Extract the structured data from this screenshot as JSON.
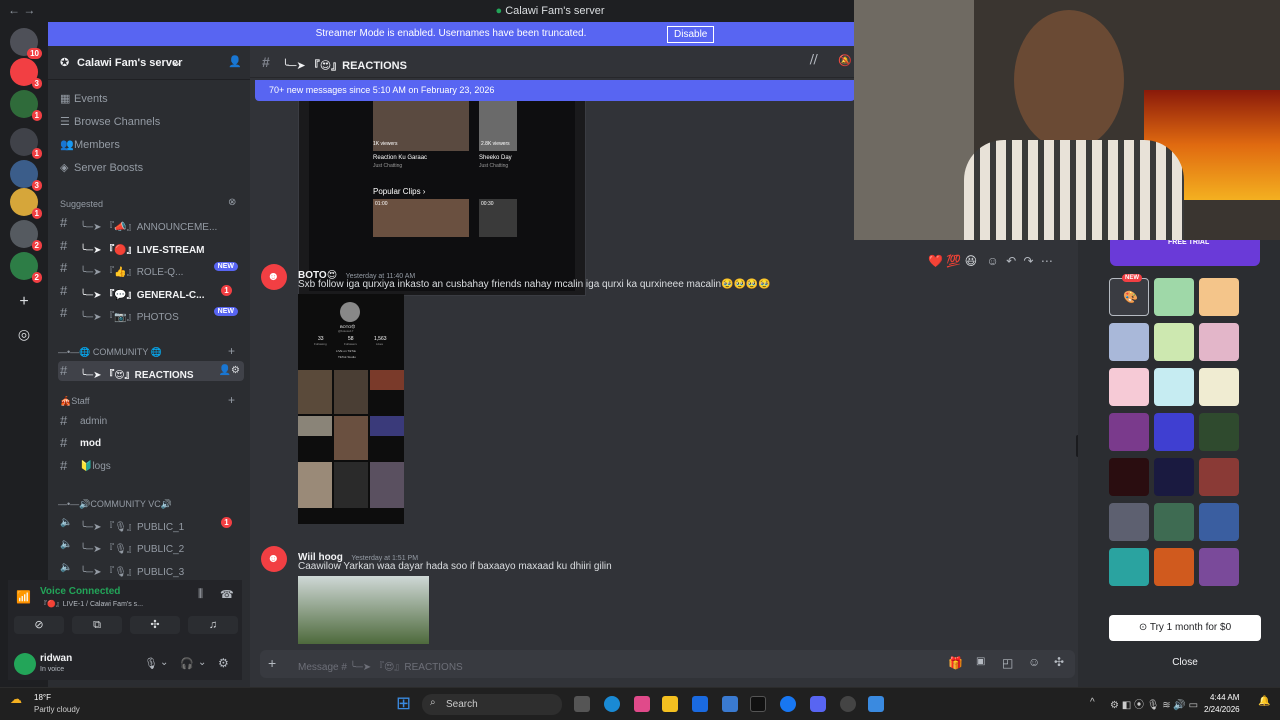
{
  "window": {
    "title": "Calawi Fam's server",
    "nav_arrows": "←  →"
  },
  "banner": {
    "text": "Streamer Mode is enabled. Usernames have been truncated.",
    "button": "Disable"
  },
  "guilds": [
    {
      "badge": "10",
      "color": "#4e5058"
    },
    {
      "badge": "3",
      "color": "#f23f43"
    },
    {
      "badge": "1",
      "color": "#2f6b3a"
    },
    {
      "badge": "1",
      "color": "#404249"
    },
    {
      "badge": "3",
      "color": "#3b5d8a"
    },
    {
      "badge": "1",
      "color": "#d6a63a"
    },
    {
      "badge": "2",
      "color": "#555a60"
    },
    {
      "badge": "2",
      "color": "#2d7d46"
    }
  ],
  "sidebar": {
    "server_name": "Calawi Fam's server",
    "nav": [
      {
        "label": "Events",
        "icon": "calendar-icon",
        "glyph": "▦"
      },
      {
        "label": "Browse Channels",
        "icon": "browse-icon",
        "glyph": "☰"
      },
      {
        "label": "Members",
        "icon": "members-icon",
        "glyph": "👥"
      },
      {
        "label": "Server Boosts",
        "icon": "boost-icon",
        "glyph": "◈"
      }
    ],
    "suggested_label": "Suggested",
    "channels_suggested": [
      {
        "name": "╰─➤ 『📣』ANNOUNCEME...",
        "badge": "",
        "bold": false
      },
      {
        "name": "╰─➤ 『🔴』LIVE-STREAM",
        "badge": "",
        "bold": true
      },
      {
        "name": "╰─➤ 『👍』ROLE-Q...",
        "badge": "NEW",
        "bold": false
      },
      {
        "name": "╰─➤ 『💬』GENERAL-C...",
        "badge": "1",
        "bold": true
      },
      {
        "name": "╰─➤ 『📷』PHOTOS",
        "badge": "NEW",
        "bold": false
      }
    ],
    "community_label": "—•—🌐 COMMUNITY 🌐",
    "active_channel": "╰─➤ 『😍』REACTIONS",
    "staff_label": "🎪Staff",
    "staff_channels": [
      "admin",
      "mod",
      "🔰logs"
    ],
    "community_vc_label": "—•—🔊COMMUNITY VC🔊",
    "voice_channels": [
      {
        "name": "╰─➤ 『🎙』PUBLIC_1",
        "badge": "1"
      },
      {
        "name": "╰─➤ 『🎙』PUBLIC_2",
        "badge": ""
      },
      {
        "name": "╰─➤ 『🎙』PUBLIC_3",
        "badge": ""
      }
    ]
  },
  "voice": {
    "status": "Voice Connected",
    "channel": "『🔴』LIVE-1 / Calawi Fam's s..."
  },
  "user": {
    "name": "ridwan",
    "status": "In voice"
  },
  "channel_header": {
    "name": "╰─➤ 『😍』REACTIONS"
  },
  "new_messages_bar": "70+ new messages since 5:10 AM on February 23, 2026",
  "embedded_preview": {
    "clip1_title": "Reaction Ku Garaac",
    "clip1_views": "1K viewers",
    "clip2_title": "Sheeko Day",
    "clip2_views": "2.8K viewers",
    "clip_sub": "Just Chatting",
    "popular_clips": "Popular Clips  ›",
    "t1": "01:00",
    "t2": "00:30"
  },
  "messages": [
    {
      "author": "BOTO😍",
      "time": "Yesterday at 11:40 AM",
      "text": "Sxb follow iga qurxiya inkasto  an cusbahay friends  nahay mcalin iga qurxi  ka qurxineee macalin🥹🥹🥹🥹",
      "profile": {
        "name": "BOTO😍",
        "handle": "@botosu17",
        "following": "33",
        "followers": "58",
        "likes": "1,563",
        "following_label": "Following",
        "followers_label": "Followers",
        "likes_label": "Likes",
        "bio": "LIVE on TikTok",
        "studio": "TikTok Studio"
      }
    },
    {
      "author": "Wiil hoog",
      "time": "Yesterday at 1:51 PM",
      "text": "Caawilow Yarkan waa dayar hada soo if baxaayo maxaad ku dhiiri gilin"
    }
  ],
  "composer": {
    "placeholder": "Message # ╰─➤ 『😍』REACTIONS"
  },
  "reactions_bar": [
    "❤️",
    "💯",
    "😆"
  ],
  "side_panel": {
    "trial_label": "FREE TRIAL",
    "new_badge": "NEW",
    "try_button": "Try 1 month for $0",
    "close_button": "Close",
    "swatches": [
      "#3a3c42",
      "#9fd8a8",
      "#f4c58a",
      "#a9b8d9",
      "#cde8b0",
      "#e3b6c9",
      "#f6cad6",
      "#c6ecf2",
      "#f0ecd2",
      "#7a3a8c",
      "#3f3fd1",
      "#2f4a2e",
      "#2a0d10",
      "#1a1a40",
      "#8a3a36",
      "#5d6070",
      "#3e6b52",
      "#3a5ea0",
      "#2aa3a0",
      "#d05a1e",
      "#7a4a9a"
    ]
  },
  "taskbar": {
    "weather_temp": "18°F",
    "weather_desc": "Partly cloudy",
    "search": "Search",
    "time": "4:44 AM",
    "date": "2/24/2026"
  },
  "colors": {
    "blurple": "#5865f2",
    "red": "#f23f43",
    "green": "#23a559"
  }
}
